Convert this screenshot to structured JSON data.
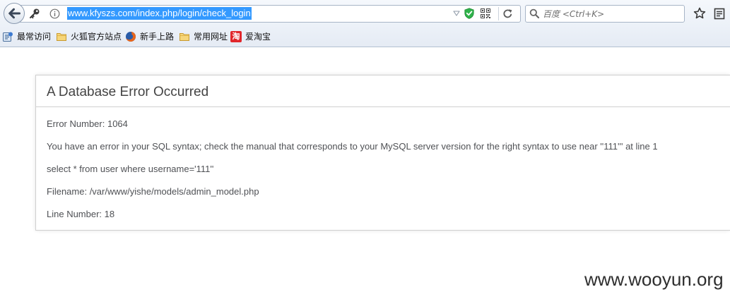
{
  "browser": {
    "back_button_icon": "back-arrow-icon",
    "address_bar": {
      "identity_icons": [
        "key-icon",
        "info-icon"
      ],
      "url": "www.kfyszs.com/index.php/login/check_login",
      "url_selected": true,
      "right_icons": [
        "dropdown-arrow-icon",
        "shield-icon",
        "qr-code-icon",
        "reload-icon"
      ]
    },
    "search": {
      "engine_icon": "search-icon",
      "placeholder": "百度 <Ctrl+K>"
    },
    "toolbar_buttons": [
      "star-icon",
      "bookmarks-menu-icon"
    ],
    "bookmarks": [
      {
        "label": "最常访问",
        "icon": "most-visited-icon"
      },
      {
        "label": "火狐官方站点",
        "icon": "folder-icon"
      },
      {
        "label": "新手上路",
        "icon": "firefox-icon"
      },
      {
        "label": "常用网址",
        "icon": "folder-icon"
      },
      {
        "label": "爱淘宝",
        "icon": "taobao-icon",
        "icon_text": "淘"
      }
    ]
  },
  "error_page": {
    "heading": "A Database Error Occurred",
    "lines": [
      "Error Number: 1064",
      "You have an error in your SQL syntax; check the manual that corresponds to your MySQL server version for the right syntax to use near ''111''' at line 1",
      "select * from user where username='111''",
      "Filename: /var/www/yishe/models/admin_model.php",
      "Line Number: 18"
    ]
  },
  "watermark": "www.wooyun.org",
  "colors": {
    "selection": "#3399ff",
    "heading_text": "#444444",
    "body_text": "#4f5155",
    "box_border": "#d0d0d0",
    "shield": "#2fb24a",
    "taobao_icon": "#e1262b"
  }
}
